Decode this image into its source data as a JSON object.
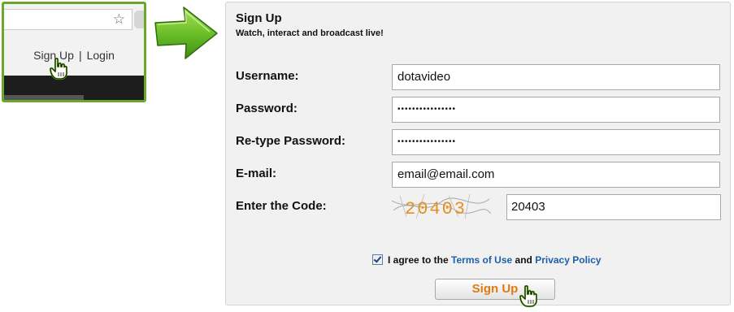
{
  "thumbnail": {
    "nav": {
      "signup_label": "Sign Up",
      "separator": "|",
      "login_label": "Login"
    },
    "icons": [
      "star-icon",
      "hand-cursor-icon"
    ]
  },
  "arrow": {
    "icon": "green-arrow-icon",
    "color": "#6ab52a"
  },
  "panel": {
    "title": "Sign Up",
    "subtitle": "Watch, interact and broadcast live!",
    "fields": {
      "username": {
        "label": "Username:",
        "value": "dotavideo"
      },
      "password": {
        "label": "Password:",
        "value": "••••••••••••••••"
      },
      "retype_password": {
        "label": "Re-type Password:",
        "value": "••••••••••••••••"
      },
      "email": {
        "label": "E-mail:",
        "value": "email@email.com"
      },
      "code": {
        "label": "Enter the Code:",
        "captcha_text": "20403",
        "value": "20403"
      }
    },
    "agree": {
      "checked": true,
      "prefix": "I agree to the",
      "terms_link": "Terms of Use",
      "conjunction": "and",
      "privacy_link": "Privacy Policy"
    },
    "submit_label": "Sign Up"
  },
  "colors": {
    "accent_orange": "#e07a12",
    "link_blue": "#1d5fa8",
    "highlight_green": "#6aa82a"
  }
}
